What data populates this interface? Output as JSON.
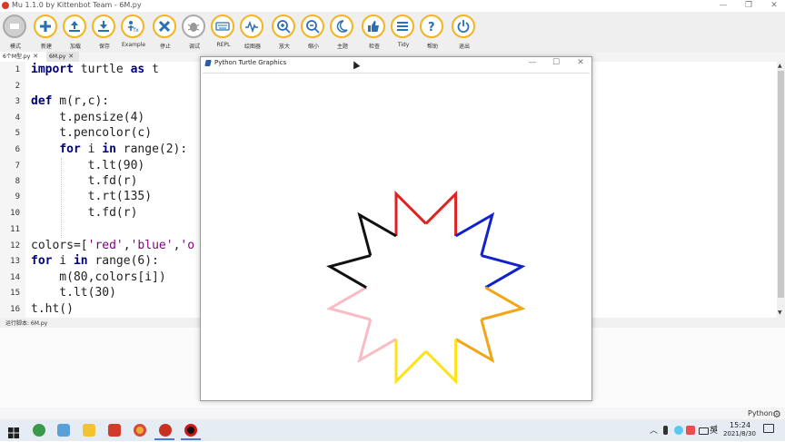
{
  "window": {
    "title": "Mu 1.1.0 by Kittenbot Team - 6M.py",
    "minimize": "—",
    "maximize": "❐",
    "close": "✕"
  },
  "toolbar": [
    {
      "label": "模式",
      "icon": "mode-icon"
    },
    {
      "label": "新建",
      "icon": "plus-icon"
    },
    {
      "label": "加载",
      "icon": "upload-icon"
    },
    {
      "label": "保存",
      "icon": "download-icon"
    },
    {
      "label": "Example",
      "icon": "example-icon"
    },
    {
      "label": "停止",
      "icon": "stop-icon"
    },
    {
      "label": "调试",
      "icon": "bug-icon"
    },
    {
      "label": "REPL",
      "icon": "keyboard-icon"
    },
    {
      "label": "绘图器",
      "icon": "plotter-icon"
    },
    {
      "label": "放大",
      "icon": "zoom-in-icon"
    },
    {
      "label": "缩小",
      "icon": "zoom-out-icon"
    },
    {
      "label": "主题",
      "icon": "moon-icon"
    },
    {
      "label": "检查",
      "icon": "thumbs-up-icon"
    },
    {
      "label": "Tidy",
      "icon": "tidy-icon"
    },
    {
      "label": "帮助",
      "icon": "help-icon"
    },
    {
      "label": "退出",
      "icon": "power-icon"
    }
  ],
  "tabs": [
    {
      "label": "6个M型.py",
      "close": "✕"
    },
    {
      "label": "6M.py",
      "close": "✕"
    }
  ],
  "editor": {
    "line_numbers": [
      "1",
      "2",
      "3",
      "4",
      "5",
      "6",
      "7",
      "8",
      "9",
      "10",
      "11",
      "12",
      "13",
      "14",
      "15",
      "16"
    ]
  },
  "status": {
    "text": "运行脚本: 6M.py"
  },
  "mode": {
    "label": "Python"
  },
  "turtle_window": {
    "title": "Python Turtle Graphics",
    "minimize": "—",
    "maximize": "☐",
    "close": "✕",
    "segment_colors": [
      "#dd2222",
      "#1122cc",
      "#f2a515",
      "#ffe21a",
      "#f9bcc2",
      "#111111"
    ]
  },
  "taskbar": {
    "time": "15:24",
    "date": "2021/8/30",
    "input_method": "英"
  }
}
